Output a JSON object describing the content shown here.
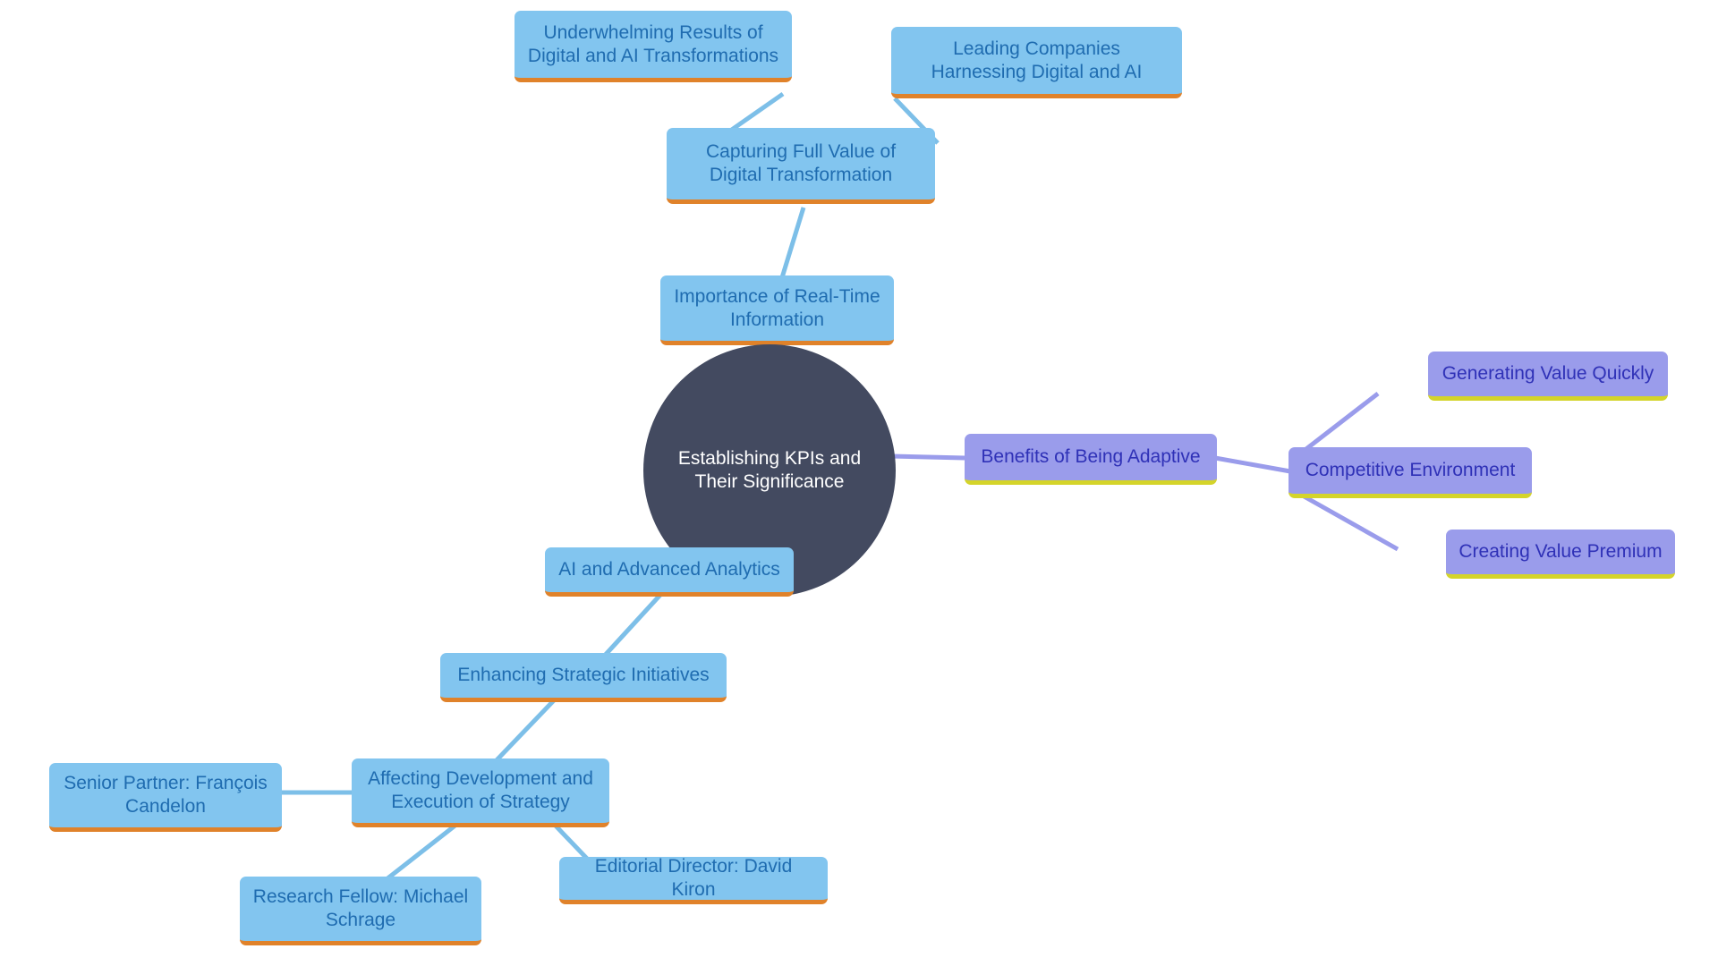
{
  "diagram": {
    "type": "mindmap",
    "title": "Establishing KPIs and Their Significance",
    "background": "#ffffff",
    "palette": {
      "root_fill": "#434a60",
      "root_text": "#ffffff",
      "blue_fill": "#82c5ef",
      "blue_text": "#1f6cb0",
      "blue_underline": "#e0822a",
      "blue_edge": "#7dbfe8",
      "purple_fill": "#9a9ceb",
      "purple_text": "#2f31b7",
      "purple_underline": "#d4d42a",
      "purple_edge": "#9a9ceb"
    }
  },
  "nodes": {
    "root": {
      "label": "Establishing KPIs and Their Significance"
    },
    "underwhelming_results": {
      "label": "Underwhelming Results of Digital and AI Transformations"
    },
    "leading_companies": {
      "label": "Leading Companies Harnessing Digital and AI"
    },
    "capturing_full_value": {
      "label": "Capturing Full Value of Digital Transformation"
    },
    "realtime_information": {
      "label": "Importance of Real-Time Information"
    },
    "benefits_adaptive": {
      "label": "Benefits of Being Adaptive"
    },
    "competitive_environment": {
      "label": "Competitive Environment"
    },
    "generating_value": {
      "label": "Generating Value Quickly"
    },
    "creating_value_premium": {
      "label": "Creating Value Premium"
    },
    "ai_advanced_analytics": {
      "label": "AI and Advanced Analytics"
    },
    "enhancing_strategic": {
      "label": "Enhancing Strategic Initiatives"
    },
    "affecting_development": {
      "label": "Affecting Development and Execution of Strategy"
    },
    "senior_partner": {
      "label": "Senior Partner: François Candelon"
    },
    "research_fellow": {
      "label": "Research Fellow: Michael Schrage"
    },
    "editorial_director": {
      "label": "Editorial Director: David Kiron"
    }
  },
  "edges": [
    {
      "from": "root",
      "to": "realtime_information",
      "color": "#7dbfe8"
    },
    {
      "from": "realtime_information",
      "to": "capturing_full_value",
      "color": "#7dbfe8"
    },
    {
      "from": "capturing_full_value",
      "to": "underwhelming_results",
      "color": "#7dbfe8"
    },
    {
      "from": "capturing_full_value",
      "to": "leading_companies",
      "color": "#7dbfe8"
    },
    {
      "from": "root",
      "to": "benefits_adaptive",
      "color": "#9a9ceb"
    },
    {
      "from": "benefits_adaptive",
      "to": "competitive_environment",
      "color": "#9a9ceb"
    },
    {
      "from": "competitive_environment",
      "to": "generating_value",
      "color": "#9a9ceb"
    },
    {
      "from": "competitive_environment",
      "to": "creating_value_premium",
      "color": "#9a9ceb"
    },
    {
      "from": "root",
      "to": "ai_advanced_analytics",
      "color": "#7dbfe8"
    },
    {
      "from": "ai_advanced_analytics",
      "to": "enhancing_strategic",
      "color": "#7dbfe8"
    },
    {
      "from": "enhancing_strategic",
      "to": "affecting_development",
      "color": "#7dbfe8"
    },
    {
      "from": "affecting_development",
      "to": "senior_partner",
      "color": "#7dbfe8"
    },
    {
      "from": "affecting_development",
      "to": "research_fellow",
      "color": "#7dbfe8"
    },
    {
      "from": "affecting_development",
      "to": "editorial_director",
      "color": "#7dbfe8"
    }
  ]
}
